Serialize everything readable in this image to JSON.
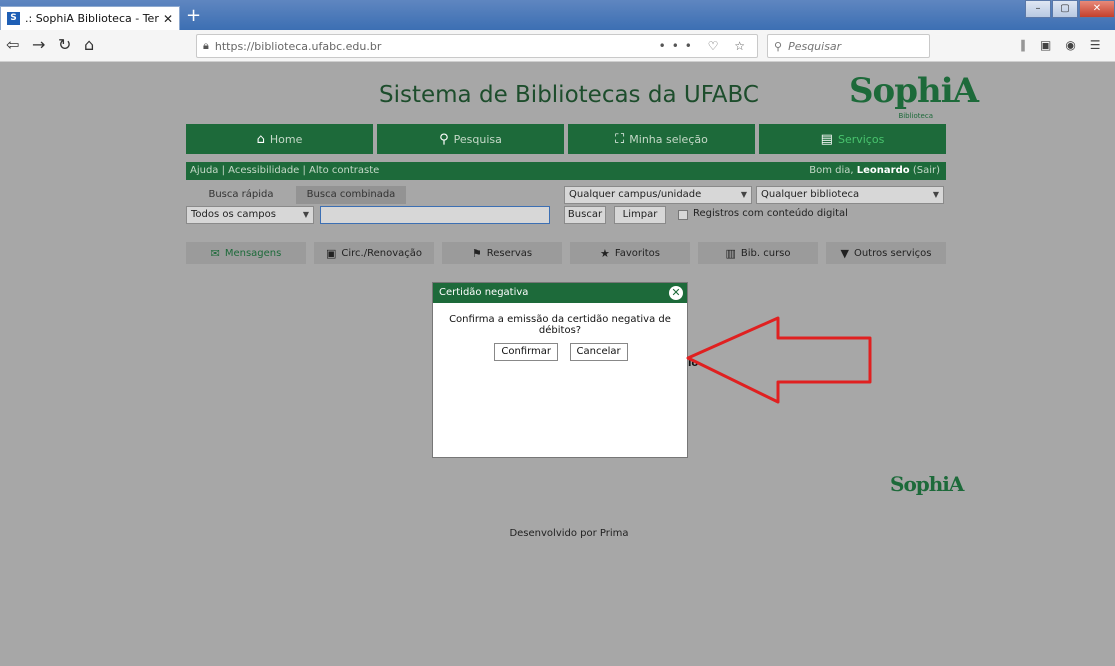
{
  "browser": {
    "tab_title": ".: SophiA Biblioteca - Terminal",
    "favicon": "S",
    "url": "https://biblioteca.ufabc.edu.br",
    "search_placeholder": "Pesquisar",
    "url_actions": "••• ♡ ☆"
  },
  "site": {
    "title": "Sistema de Bibliotecas da UFABC",
    "logo": "SophiA",
    "logo_sub": "Biblioteca"
  },
  "mainnav": [
    {
      "label": "Home",
      "icon": "home-icon",
      "glyph": "⌂"
    },
    {
      "label": "Pesquisa",
      "icon": "search-icon",
      "glyph": "🔍"
    },
    {
      "label": "Minha seleção",
      "icon": "basket-icon",
      "glyph": "⛫"
    },
    {
      "label": "Serviços",
      "icon": "services-icon",
      "glyph": "▤"
    }
  ],
  "toplinks": {
    "left": "Ajuda  |  Acessibilidade  |  Alto contraste",
    "greeting_prefix": "Bom dia, ",
    "user": "Leonardo",
    "sair": " (Sair)"
  },
  "search": {
    "tab_quick": "Busca rápida",
    "tab_combined": "Busca combinada",
    "field_select": "Todos os campos",
    "campus_select": "Qualquer campus/unidade",
    "library_select": "Qualquer biblioteca",
    "buscar": "Buscar",
    "limpar": "Limpar",
    "digital_label": "Registros com conteúdo digital"
  },
  "services": [
    {
      "label": "Mensagens",
      "icon": "envelope-icon",
      "glyph": "✉"
    },
    {
      "label": "Circ./Renovação",
      "icon": "circulation-icon",
      "glyph": "▣"
    },
    {
      "label": "Reservas",
      "icon": "flag-icon",
      "glyph": "⚑"
    },
    {
      "label": "Favoritos",
      "icon": "star-icon",
      "glyph": "★"
    },
    {
      "label": "Bib. curso",
      "icon": "books-icon",
      "glyph": "▥"
    },
    {
      "label": "Outros serviços",
      "icon": "caret-down-icon",
      "glyph": "▼"
    }
  ],
  "footer": {
    "logo": "SophiA",
    "text": "Desenvolvido por Prima"
  },
  "modal": {
    "title": "Certidão negativa",
    "message": "Confirma a emissão da certidão negativa de débitos?",
    "confirm": "Confirmar",
    "cancel": "Cancelar",
    "peek_text": "lo"
  },
  "colors": {
    "brand_green": "#1d6a3a",
    "page_bg": "#a7a7a7",
    "arrow_red": "#e02020"
  }
}
